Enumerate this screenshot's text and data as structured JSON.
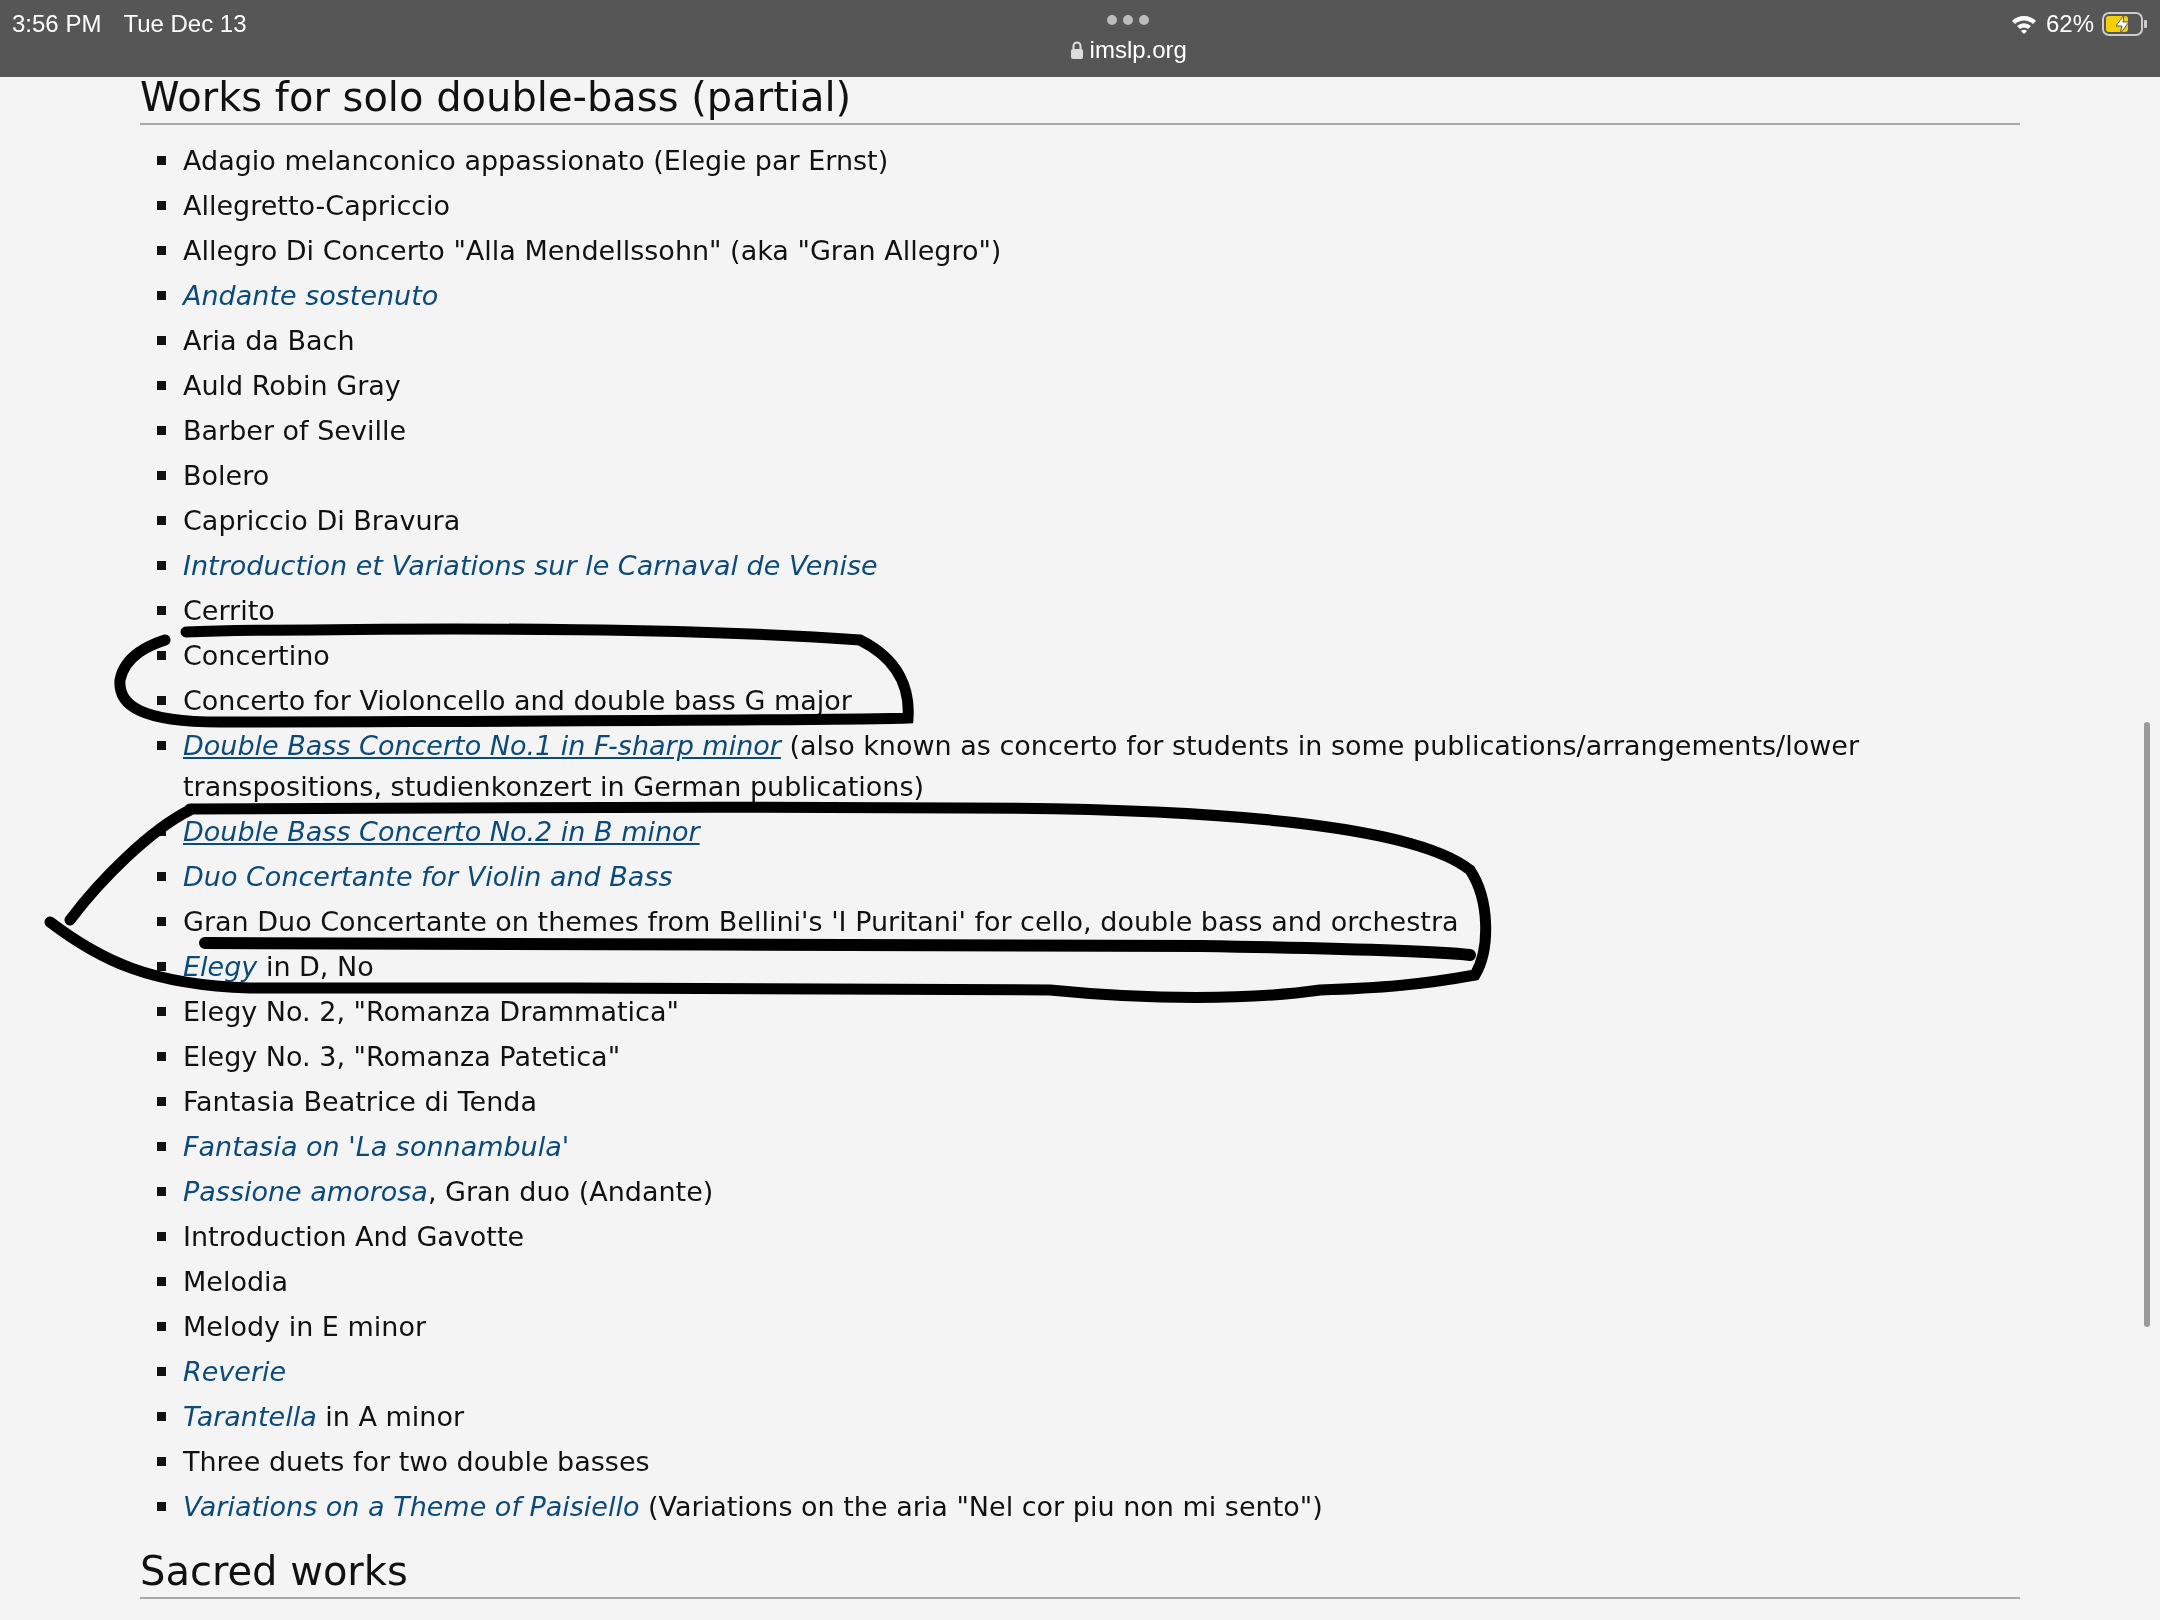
{
  "status_bar": {
    "time": "3:56 PM",
    "date": "Tue Dec 13",
    "url": "imslp.org",
    "battery": "62%"
  },
  "sections": [
    {
      "heading": "Works for solo double-bass (partial)",
      "items": [
        {
          "parts": [
            {
              "text": "Adagio melanconico appassionato (Elegie par Ernst)",
              "link": false
            }
          ]
        },
        {
          "parts": [
            {
              "text": "Allegretto-Capriccio",
              "link": false
            }
          ]
        },
        {
          "parts": [
            {
              "text": "Allegro Di Concerto \"Alla Mendellssohn\" (aka \"Gran Allegro\")",
              "link": false
            }
          ]
        },
        {
          "parts": [
            {
              "text": "Andante sostenuto",
              "link": true
            }
          ]
        },
        {
          "parts": [
            {
              "text": "Aria da Bach",
              "link": false
            }
          ]
        },
        {
          "parts": [
            {
              "text": "Auld Robin Gray",
              "link": false
            }
          ]
        },
        {
          "parts": [
            {
              "text": "Barber of Seville",
              "link": false
            }
          ]
        },
        {
          "parts": [
            {
              "text": "Bolero",
              "link": false
            }
          ]
        },
        {
          "parts": [
            {
              "text": "Capriccio Di Bravura",
              "link": false
            }
          ]
        },
        {
          "parts": [
            {
              "text": "Introduction et Variations sur le Carnaval de Venise",
              "link": true
            }
          ]
        },
        {
          "parts": [
            {
              "text": "Cerrito",
              "link": false
            }
          ]
        },
        {
          "parts": [
            {
              "text": "Concertino",
              "link": false
            }
          ]
        },
        {
          "parts": [
            {
              "text": "Concerto for Violoncello and double bass G major",
              "link": false
            }
          ]
        },
        {
          "parts": [
            {
              "text": "Double Bass Concerto No.1 in F-sharp minor",
              "link": true,
              "underlined": true
            },
            {
              "text": " (also known as concerto for students in some publications/arrangements/lower transpositions, studienkonzert in German publications)",
              "link": false
            }
          ]
        },
        {
          "parts": [
            {
              "text": "Double Bass Concerto No.2 in B minor",
              "link": true,
              "underlined": true
            }
          ]
        },
        {
          "parts": [
            {
              "text": "Duo Concertante for Violin and Bass",
              "link": true
            }
          ]
        },
        {
          "parts": [
            {
              "text": "Gran Duo Concertante on themes from Bellini's 'I Puritani' for cello, double bass and orchestra",
              "link": false
            }
          ]
        },
        {
          "parts": [
            {
              "text": "Elegy",
              "link": true
            },
            {
              "text": " in D, No",
              "link": false
            }
          ]
        },
        {
          "parts": [
            {
              "text": "Elegy No. 2, \"Romanza Drammatica\"",
              "link": false
            }
          ]
        },
        {
          "parts": [
            {
              "text": "Elegy No. 3, \"Romanza Patetica\"",
              "link": false
            }
          ]
        },
        {
          "parts": [
            {
              "text": "Fantasia Beatrice di Tenda",
              "link": false
            }
          ]
        },
        {
          "parts": [
            {
              "text": "Fantasia on 'La sonnambula'",
              "link": true
            }
          ]
        },
        {
          "parts": [
            {
              "text": "Passione amorosa",
              "link": true
            },
            {
              "text": ", Gran duo (Andante)",
              "link": false
            }
          ]
        },
        {
          "parts": [
            {
              "text": "Introduction And Gavotte",
              "link": false
            }
          ]
        },
        {
          "parts": [
            {
              "text": "Melodia",
              "link": false
            }
          ]
        },
        {
          "parts": [
            {
              "text": "Melody in E minor",
              "link": false
            }
          ]
        },
        {
          "parts": [
            {
              "text": "Reverie",
              "link": true
            }
          ]
        },
        {
          "parts": [
            {
              "text": "Tarantella",
              "link": true
            },
            {
              "text": " in A minor",
              "link": false
            }
          ]
        },
        {
          "parts": [
            {
              "text": "Three duets for two double basses",
              "link": false
            }
          ]
        },
        {
          "parts": [
            {
              "text": "Variations on a Theme of Paisiello",
              "link": true
            },
            {
              "text": " (Variations on the aria \"Nel cor piu non mi sento\")",
              "link": false
            }
          ]
        }
      ]
    },
    {
      "heading": "Sacred works"
    }
  ]
}
